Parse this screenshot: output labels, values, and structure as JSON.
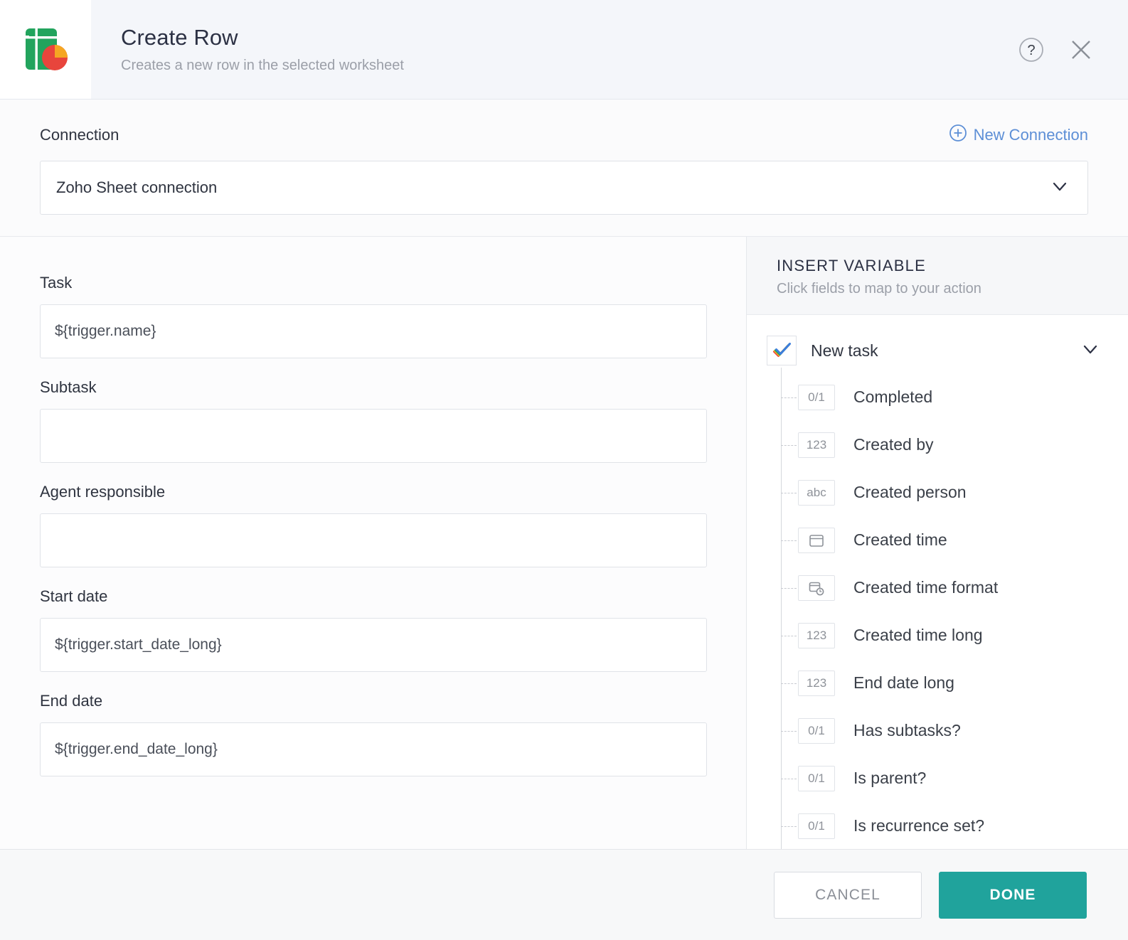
{
  "header": {
    "title": "Create Row",
    "subtitle": "Creates a new row in the selected worksheet",
    "help_icon": "help-circle-icon",
    "close_icon": "close-icon",
    "app_icon": "zoho-sheet-icon"
  },
  "connection": {
    "label": "Connection",
    "new_connection_label": "New Connection",
    "new_connection_icon": "plus-circle-icon",
    "selected_value": "Zoho Sheet connection",
    "chevron_icon": "chevron-down-icon",
    "link_color": "#5d8fd6"
  },
  "form": {
    "fields": [
      {
        "label": "Task",
        "value": "${trigger.name}",
        "placeholder": ""
      },
      {
        "label": "Subtask",
        "value": "",
        "placeholder": ""
      },
      {
        "label": "Agent responsible",
        "value": "",
        "placeholder": ""
      },
      {
        "label": "Start date",
        "value": "${trigger.start_date_long}",
        "placeholder": ""
      },
      {
        "label": "End date",
        "value": "${trigger.end_date_long}",
        "placeholder": ""
      }
    ]
  },
  "insert_variable": {
    "title": "INSERT VARIABLE",
    "subtitle": "Click fields to map to your action",
    "group": {
      "label": "New task",
      "icon": "colored-checkmark-icon",
      "chevron_icon": "chevron-down-icon"
    },
    "items": [
      {
        "type": "0/1",
        "label": "Completed"
      },
      {
        "type": "123",
        "label": "Created by"
      },
      {
        "type": "abc",
        "label": "Created person"
      },
      {
        "type": "calendar",
        "label": "Created time"
      },
      {
        "type": "calendar-clock",
        "label": "Created time format"
      },
      {
        "type": "123",
        "label": "Created time long"
      },
      {
        "type": "123",
        "label": "End date long"
      },
      {
        "type": "0/1",
        "label": "Has subtasks?"
      },
      {
        "type": "0/1",
        "label": "Is parent?"
      },
      {
        "type": "0/1",
        "label": "Is recurrence set?"
      }
    ]
  },
  "footer": {
    "cancel_label": "CANCEL",
    "done_label": "DONE",
    "done_color": "#20a39c"
  }
}
